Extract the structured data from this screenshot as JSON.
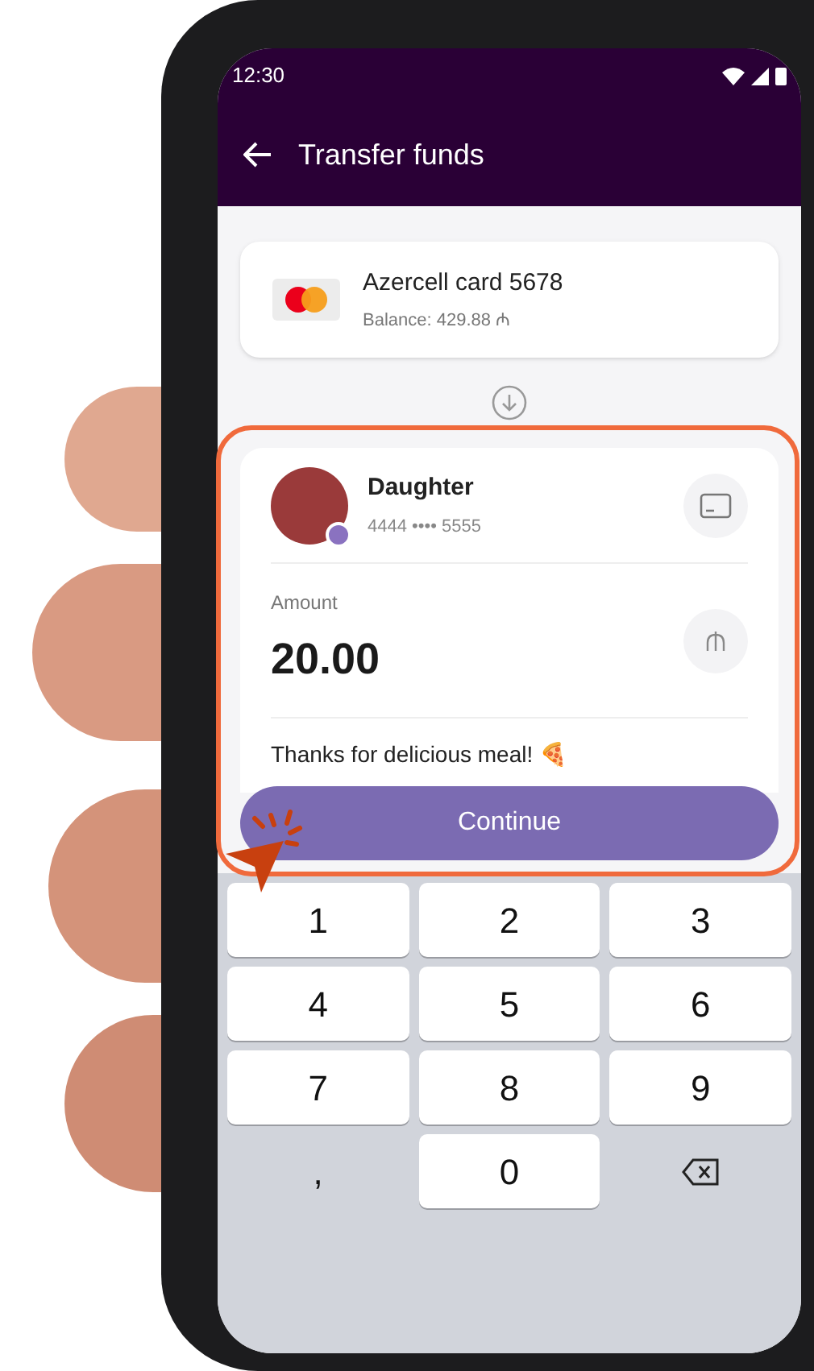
{
  "status_bar": {
    "time": "12:30"
  },
  "header": {
    "title": "Transfer funds"
  },
  "source_card": {
    "name": "Azercell card 5678",
    "balance": "Balance: 429.88 ₼"
  },
  "recipient": {
    "name": "Daughter",
    "card_number": "4444 •••• 5555"
  },
  "amount": {
    "label": "Amount",
    "value": "20.00"
  },
  "note": "Thanks for delicious meal! 🍕",
  "continue_button": "Continue",
  "keypad": [
    {
      "kind": "digit",
      "label": "1"
    },
    {
      "kind": "digit",
      "label": "2"
    },
    {
      "kind": "digit",
      "label": "3"
    },
    {
      "kind": "digit",
      "label": "4"
    },
    {
      "kind": "digit",
      "label": "5"
    },
    {
      "kind": "digit",
      "label": "6"
    },
    {
      "kind": "digit",
      "label": "7"
    },
    {
      "kind": "digit",
      "label": "8"
    },
    {
      "kind": "digit",
      "label": "9"
    },
    {
      "kind": "symbol",
      "label": ","
    },
    {
      "kind": "digit",
      "label": "0"
    },
    {
      "kind": "backspace"
    }
  ]
}
